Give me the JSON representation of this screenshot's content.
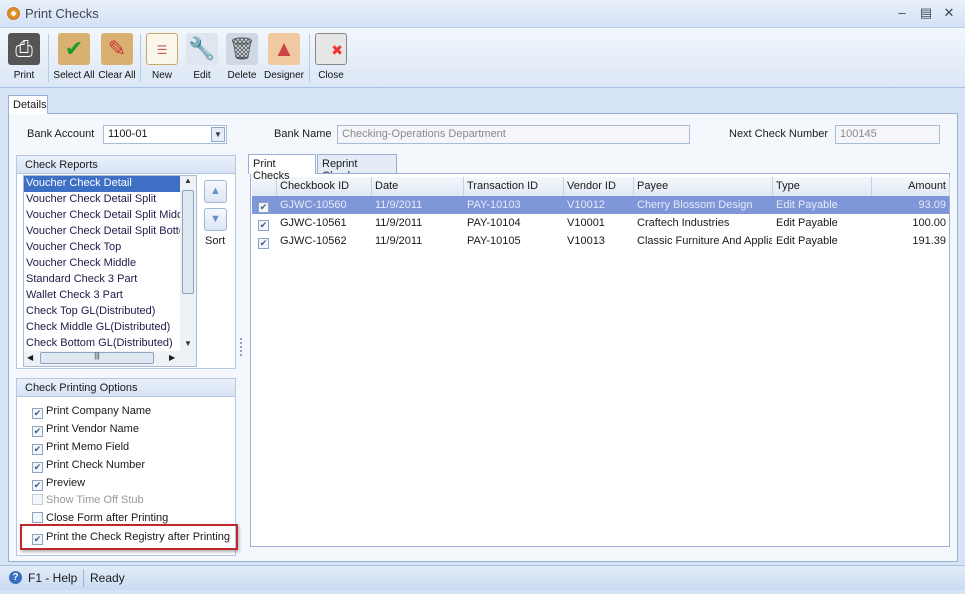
{
  "window": {
    "title": "Print Checks",
    "controls": [
      "minimize",
      "maximize",
      "close"
    ]
  },
  "toolbar": [
    {
      "label": "Print",
      "icon": "printer-icon"
    },
    {
      "label": "Select All",
      "icon": "clipboard-check-icon"
    },
    {
      "label": "Clear All",
      "icon": "clipboard-eraser-icon"
    },
    {
      "label": "New",
      "icon": "new-document-icon"
    },
    {
      "label": "Edit",
      "icon": "wrench-icon"
    },
    {
      "label": "Delete",
      "icon": "trash-icon"
    },
    {
      "label": "Designer",
      "icon": "designer-icon"
    },
    {
      "label": "Close",
      "icon": "close-window-icon"
    }
  ],
  "tabs": {
    "details": "Details"
  },
  "fields": {
    "bank_account_label": "Bank Account",
    "bank_account": "1100-01",
    "bank_name_label": "Bank Name",
    "bank_name": "Checking-Operations Department",
    "next_check_label": "Next Check Number",
    "next_check": "100145"
  },
  "reports": {
    "title": "Check Reports",
    "sort_label": "Sort",
    "items": [
      "Voucher Check Detail",
      "Voucher Check Detail Split",
      "Voucher Check Detail Split Middle",
      "Voucher Check Detail Split Bottom",
      "Voucher Check Top",
      "Voucher Check Middle",
      "Standard Check 3 Part",
      "Wallet Check 3 Part",
      "Check Top GL(Distributed)",
      "Check Middle GL(Distributed)",
      "Check Bottom GL(Distributed)"
    ],
    "selected": 0
  },
  "options": {
    "title": "Check Printing Options",
    "items": [
      {
        "label": "Print Company Name",
        "checked": true,
        "enabled": true
      },
      {
        "label": "Print Vendor Name",
        "checked": true,
        "enabled": true
      },
      {
        "label": "Print Memo Field",
        "checked": true,
        "enabled": true
      },
      {
        "label": "Print Check Number",
        "checked": true,
        "enabled": true
      },
      {
        "label": "Preview",
        "checked": true,
        "enabled": true
      },
      {
        "label": "Show Time Off Stub",
        "checked": false,
        "enabled": false
      },
      {
        "label": "Close Form after Printing",
        "checked": false,
        "enabled": true
      },
      {
        "label": "Print the Check Registry after Printing",
        "checked": true,
        "enabled": true,
        "highlighted": true
      }
    ]
  },
  "grid": {
    "tabs": [
      "Print Checks",
      "Reprint Checks"
    ],
    "active_tab": 0,
    "columns": [
      "Checkbook ID",
      "Date",
      "Transaction ID",
      "Vendor ID",
      "Payee",
      "Type",
      "Amount"
    ],
    "rows": [
      {
        "checked": true,
        "cells": [
          "GJWC-10560",
          "11/9/2011",
          "PAY-10103",
          "V10012",
          "Cherry Blossom Design",
          "Edit Payable",
          "93.09"
        ]
      },
      {
        "checked": true,
        "cells": [
          "GJWC-10561",
          "11/9/2011",
          "PAY-10104",
          "V10001",
          "Craftech Industries",
          "Edit Payable",
          "100.00"
        ]
      },
      {
        "checked": true,
        "cells": [
          "GJWC-10562",
          "11/9/2011",
          "PAY-10105",
          "V10013",
          "Classic Furniture And Applia",
          "Edit Payable",
          "191.39"
        ]
      }
    ],
    "selected_row": 0
  },
  "status": {
    "help": "F1 - Help",
    "state": "Ready"
  },
  "colors": {
    "selection": "#3d6fc5",
    "row_selection": "#7f96d8",
    "highlight_border": "#c0262b"
  }
}
